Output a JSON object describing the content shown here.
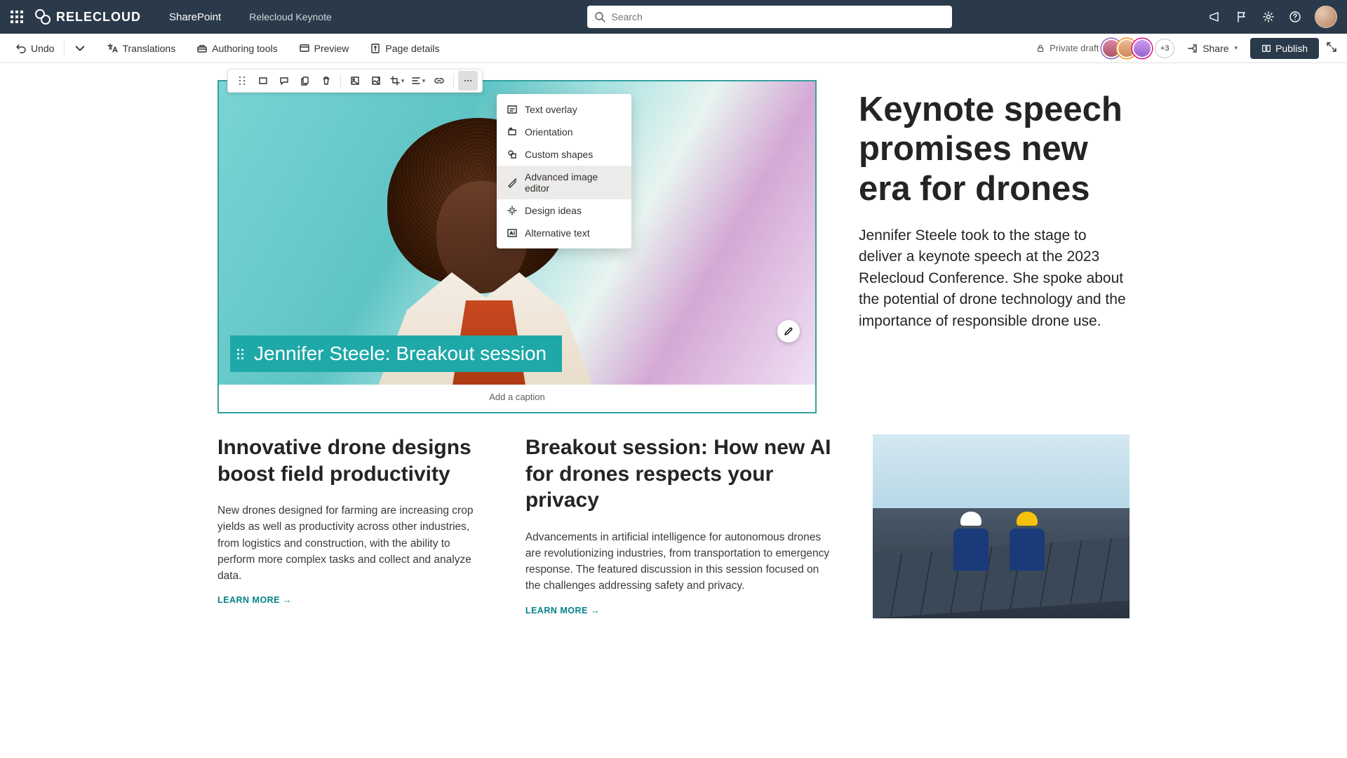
{
  "topnav": {
    "brand": "RELECLOUD",
    "product": "SharePoint",
    "breadcrumb": "Relecloud Keynote",
    "search_placeholder": "Search"
  },
  "cmdbar": {
    "undo": "Undo",
    "translations": "Translations",
    "authoring": "Authoring tools",
    "preview": "Preview",
    "pagedetails": "Page details",
    "draft": "Private draft",
    "more_count": "+3",
    "share": "Share",
    "publish": "Publish"
  },
  "dropdown": {
    "text_overlay": "Text overlay",
    "orientation": "Orientation",
    "custom_shapes": "Custom shapes",
    "advanced": "Advanced image editor",
    "design_ideas": "Design ideas",
    "alt_text": "Alternative text"
  },
  "hero": {
    "overlay_text": "Jennifer Steele: Breakout session",
    "caption_placeholder": "Add a caption"
  },
  "article": {
    "headline": "Keynote speech promises new era for drones",
    "lede": "Jennifer Steele took to the stage to deliver a keynote speech at the 2023 Relecloud Conference. She spoke about the potential of drone technology and the importance of responsible drone use."
  },
  "col1": {
    "title": "Innovative drone designs boost field productivity",
    "body": "New drones designed for farming are increasing crop yields as well as productivity across other industries, from logistics and construction, with the ability to perform more complex tasks and collect and analyze data.",
    "link": "LEARN MORE →"
  },
  "col2": {
    "title": "Breakout session: How new AI for drones respects your privacy",
    "body": "Advancements in artificial intelligence for autonomous drones are revolutionizing industries, from transportation to emergency response. The featured discussion in this session focused on the challenges addressing safety and privacy.",
    "link": "LEARN MORE →"
  }
}
